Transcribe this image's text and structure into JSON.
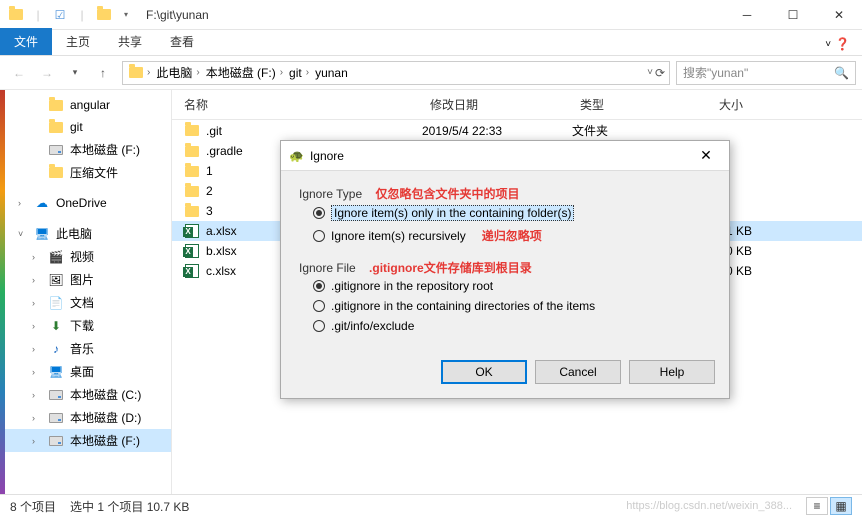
{
  "window": {
    "title_path": "F:\\git\\yunan"
  },
  "ribbon": {
    "file": "文件",
    "home": "主页",
    "share": "共享",
    "view": "查看"
  },
  "breadcrumb": {
    "this_pc": "此电脑",
    "drive": "本地磁盘 (F:)",
    "folder1": "git",
    "folder2": "yunan"
  },
  "search": {
    "placeholder": "搜索\"yunan\""
  },
  "tree": {
    "angular": "angular",
    "git": "git",
    "drive_f": "本地磁盘 (F:)",
    "compressed": "压缩文件",
    "onedrive": "OneDrive",
    "this_pc": "此电脑",
    "videos": "视频",
    "pictures": "图片",
    "documents": "文档",
    "downloads": "下载",
    "music": "音乐",
    "desktop": "桌面",
    "drive_c": "本地磁盘 (C:)",
    "drive_d": "本地磁盘 (D:)",
    "drive_f2": "本地磁盘 (F:)"
  },
  "columns": {
    "name": "名称",
    "date": "修改日期",
    "type": "类型",
    "size": "大小"
  },
  "files": [
    {
      "name": ".git",
      "date": "2019/5/4 22:33",
      "type": "文件夹",
      "size": ""
    },
    {
      "name": ".gradle",
      "date": "",
      "type": "",
      "size": ""
    },
    {
      "name": "1",
      "date": "",
      "type": "",
      "size": ""
    },
    {
      "name": "2",
      "date": "",
      "type": "",
      "size": ""
    },
    {
      "name": "3",
      "date": "",
      "type": "",
      "size": ""
    },
    {
      "name": "a.xlsx",
      "date": "",
      "type": "",
      "size": "11 KB"
    },
    {
      "name": "b.xlsx",
      "date": "",
      "type": "",
      "size": "10 KB"
    },
    {
      "name": "c.xlsx",
      "date": "",
      "type": "",
      "size": "10 KB"
    }
  ],
  "status": {
    "count": "8 个项目",
    "selected": "选中 1 个项目  10.7 KB",
    "watermark": "https://blog.csdn.net/weixin_388..."
  },
  "dialog": {
    "title": "Ignore",
    "ignore_type_label": "Ignore Type",
    "ignore_type_annotation": "仅忽略包含文件夹中的项目",
    "opt_containing": "Ignore item(s) only in the containing folder(s)",
    "opt_recursive": "Ignore item(s) recursively",
    "recursive_annotation": "递归忽略项",
    "ignore_file_label": "Ignore File",
    "ignore_file_annotation": ".gitignore文件存储库到根目录",
    "opt_root": ".gitignore in the repository root",
    "opt_dirs": ".gitignore in the containing directories of the items",
    "opt_exclude": ".git/info/exclude",
    "ok": "OK",
    "cancel": "Cancel",
    "help": "Help"
  }
}
